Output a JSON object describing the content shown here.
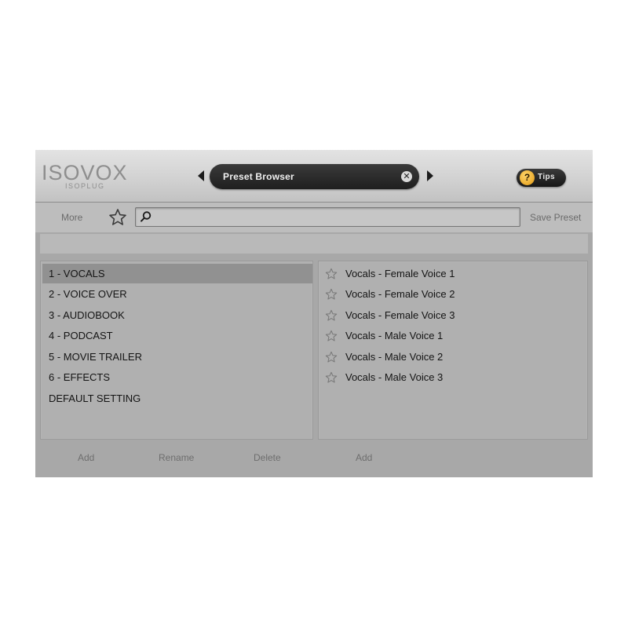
{
  "header": {
    "logo_main": "ISOVOX",
    "logo_sub": "ISOPLUG",
    "preset_title": "Preset Browser",
    "tips_label": "Tips",
    "tips_icon_glyph": "?"
  },
  "toolbar": {
    "more_label": "More",
    "search_value": "",
    "search_placeholder": "",
    "save_preset_label": "Save Preset"
  },
  "categories": [
    {
      "label": "1 - VOCALS",
      "selected": true
    },
    {
      "label": "2 - VOICE OVER",
      "selected": false
    },
    {
      "label": "3 - AUDIOBOOK",
      "selected": false
    },
    {
      "label": "4 - PODCAST",
      "selected": false
    },
    {
      "label": "5 - MOVIE TRAILER",
      "selected": false
    },
    {
      "label": "6 - EFFECTS",
      "selected": false
    },
    {
      "label": "DEFAULT SETTING",
      "selected": false
    }
  ],
  "presets": [
    {
      "label": "Vocals - Female Voice 1",
      "favorite": false
    },
    {
      "label": "Vocals - Female Voice 2",
      "favorite": false
    },
    {
      "label": "Vocals - Female Voice 3",
      "favorite": false
    },
    {
      "label": "Vocals - Male Voice 1",
      "favorite": false
    },
    {
      "label": "Vocals - Male Voice 2",
      "favorite": false
    },
    {
      "label": "Vocals - Male Voice 3",
      "favorite": false
    }
  ],
  "footer": {
    "left_add": "Add",
    "rename": "Rename",
    "delete": "Delete",
    "right_add": "Add"
  },
  "colors": {
    "app_bg": "#a8a8a8",
    "selected_row": "#919191",
    "tips_accent": "#e29a14",
    "preset_bar": "#1f1f1f"
  }
}
